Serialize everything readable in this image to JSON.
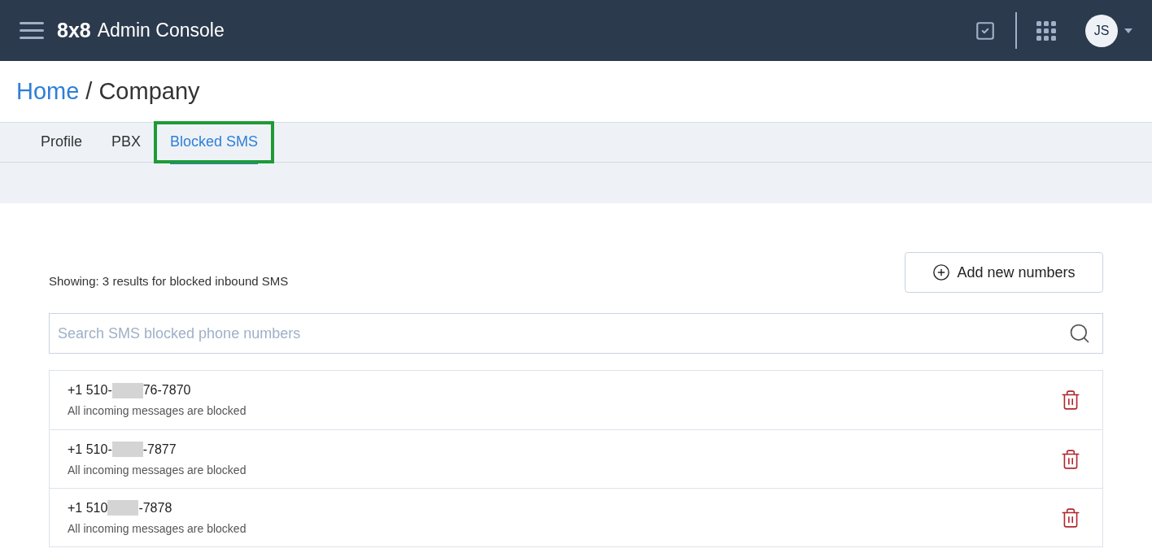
{
  "header": {
    "logo": "8x8",
    "title": "Admin Console",
    "avatar": "JS"
  },
  "breadcrumb": {
    "link": "Home",
    "separator": "/",
    "current": "Company"
  },
  "tabs": [
    {
      "label": "Profile",
      "selected": false,
      "highlighted": false
    },
    {
      "label": "PBX",
      "selected": false,
      "highlighted": false
    },
    {
      "label": "Blocked SMS",
      "selected": true,
      "highlighted": true
    }
  ],
  "summary": "Showing: 3 results for blocked inbound SMS",
  "add_button": "Add new numbers",
  "search": {
    "placeholder": "Search SMS blocked phone numbers"
  },
  "numbers": [
    {
      "prefix": "+1 510-",
      "redacted": true,
      "suffix": "76-7870",
      "status": "All incoming messages are blocked"
    },
    {
      "prefix": "+1 510-",
      "redacted": true,
      "suffix": "-7877",
      "status": "All incoming messages are blocked"
    },
    {
      "prefix": "+1 510",
      "redacted": true,
      "suffix": "-7878",
      "status": "All incoming messages are blocked"
    }
  ]
}
